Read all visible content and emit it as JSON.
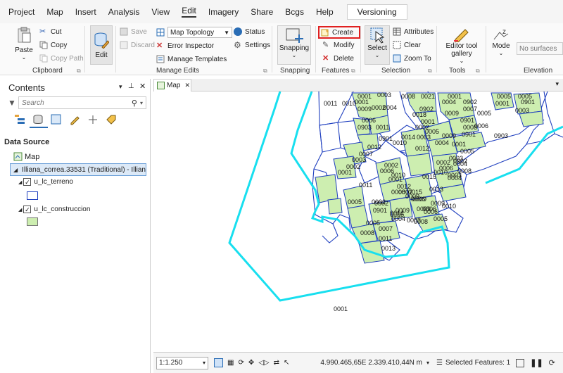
{
  "menu": {
    "items": [
      "Project",
      "Map",
      "Insert",
      "Analysis",
      "View",
      "Edit",
      "Imagery",
      "Share",
      "Bcgs",
      "Help"
    ],
    "active": "Edit",
    "versioning": "Versioning"
  },
  "ribbon": {
    "clipboard": {
      "paste": "Paste",
      "cut": "Cut",
      "copy": "Copy",
      "copy_path": "Copy Path",
      "label": "Clipboard"
    },
    "edit": {
      "label": "Edit"
    },
    "manage_edits": {
      "save": "Save",
      "discard": "Discard",
      "map_topology": "Map Topology",
      "error_inspector": "Error Inspector",
      "manage_templates": "Manage Templates",
      "status": "Status",
      "settings": "Settings",
      "label": "Manage Edits"
    },
    "snapping": {
      "snapping": "Snapping",
      "label": "Snapping"
    },
    "features": {
      "create": "Create",
      "modify": "Modify",
      "delete": "Delete",
      "label": "Features"
    },
    "selection": {
      "select": "Select",
      "attributes": "Attributes",
      "clear": "Clear",
      "zoom_to": "Zoom To",
      "label": "Selection"
    },
    "tools": {
      "gallery_line1": "Editor tool",
      "gallery_line2": "gallery",
      "label": "Tools"
    },
    "elevation": {
      "mode": "Mode",
      "surface_placeholder": "No surfaces",
      "label": "Elevation"
    }
  },
  "contents": {
    "title": "Contents",
    "search_placeholder": "Search",
    "data_source": "Data Source",
    "map_node": "Map",
    "db_node": "Illiana_correa.33531 (Traditional) - Illian...",
    "layer1": "u_lc_terreno",
    "layer2": "u_lc_construccion"
  },
  "map_tab": {
    "label": "Map"
  },
  "map": {
    "terreno_color": "#1f3fbf",
    "construccion_fill": "#cdeeb0",
    "selected_color": "#18dfef",
    "labels": [
      "0011",
      "0010",
      "0001",
      "0003",
      "0008",
      "0021",
      "0001",
      "0005",
      "0005",
      "0001",
      "0009",
      "0002",
      "0004",
      "0018",
      "0902",
      "0004",
      "0902",
      "0001",
      "0901",
      "0001",
      "0009",
      "0007",
      "0006",
      "0011",
      "0005",
      "0003",
      "0903",
      "0901",
      "0002",
      "0901",
      "0006",
      "0012",
      "0005",
      "0009",
      "0008",
      "0003",
      "0901",
      "0014",
      "0004",
      "0012",
      "0005",
      "0903",
      "0010",
      "0007",
      "0003",
      "0001",
      "0002",
      "0003",
      "0008",
      "0006",
      "0004",
      "0002",
      "0001",
      "0002",
      "0010",
      "0902",
      "0003",
      "0009",
      "0014",
      "0015",
      "0013",
      "0004",
      "0009",
      "0008",
      "0015",
      "0011",
      "0006",
      "0007",
      "0012",
      "0001",
      "0006",
      "0009",
      "0010",
      "0005",
      "0002",
      "0010",
      "0004",
      "0006",
      "0009",
      "0901",
      "0005",
      "0002",
      "0006",
      "0007",
      "0009",
      "0003",
      "0008",
      "0008",
      "0006",
      "0005",
      "0011",
      "0013",
      "0001"
    ]
  },
  "status": {
    "scale": "1:1.250",
    "coords": "4.990.465,65E 2.339.410,44N m",
    "selected": "Selected Features: 1"
  }
}
